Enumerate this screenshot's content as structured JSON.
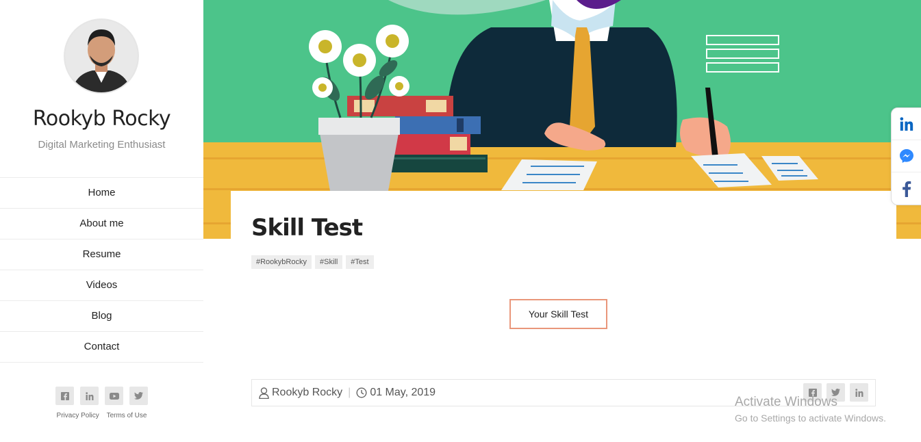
{
  "profile": {
    "name": "Rookyb Rocky",
    "tagline": "Digital Marketing Enthusiast"
  },
  "nav": [
    {
      "label": "Home"
    },
    {
      "label": "About me"
    },
    {
      "label": "Resume"
    },
    {
      "label": "Videos"
    },
    {
      "label": "Blog"
    },
    {
      "label": "Contact"
    }
  ],
  "sidebar_social": [
    "facebook-icon",
    "linkedin-icon",
    "youtube-icon",
    "twitter-icon"
  ],
  "legal": {
    "privacy": "Privacy Policy",
    "terms": "Terms of Use"
  },
  "post": {
    "title": "Skill Test",
    "tags": [
      "#RookybRocky",
      "#Skill",
      "#Test"
    ],
    "cta_label": "Your Skill Test",
    "author": "Rookyb Rocky",
    "date": "01 May, 2019"
  },
  "post_share": [
    "facebook-icon",
    "twitter-icon",
    "linkedin-icon"
  ],
  "floating_share": [
    "linkedin-icon",
    "messenger-icon",
    "facebook-icon"
  ],
  "windows_notice": {
    "line1": "Activate Windows",
    "line2": "Go to Settings to activate Windows."
  },
  "colors": {
    "hero_green": "#4cc48a",
    "desk_yellow": "#f0b93c",
    "cta_border": "#e9967a",
    "linkedin": "#0a66c2",
    "messenger": "#2e89ff",
    "facebook": "#3b5998"
  }
}
